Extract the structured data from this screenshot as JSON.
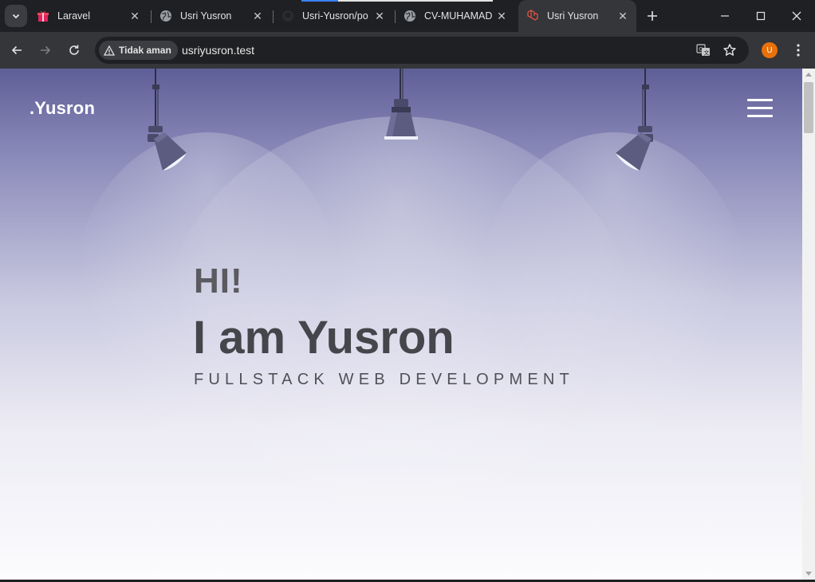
{
  "browser": {
    "tabs": [
      {
        "title": "Laravel",
        "icon": "gift-icon",
        "active": false
      },
      {
        "title": "Usri Yusron",
        "icon": "globe-icon",
        "active": false
      },
      {
        "title": "Usri-Yusron/po",
        "icon": "github-icon",
        "active": false
      },
      {
        "title": "CV-MUHAMAD",
        "icon": "globe-icon",
        "active": false
      },
      {
        "title": "Usri Yusron",
        "icon": "laravel-icon",
        "active": true
      }
    ],
    "security_chip": "Tidak aman",
    "url": "usriyusron.test",
    "profile_initial": "U",
    "colors": {
      "frame": "#1f2023",
      "toolbar": "#35363a",
      "profile": "#e8710a"
    }
  },
  "page": {
    "logo": ".Yusron",
    "greeting": "HI!",
    "headline": "I am Yusron",
    "subtitle": "FULLSTACK WEB DEVELOPMENT"
  }
}
